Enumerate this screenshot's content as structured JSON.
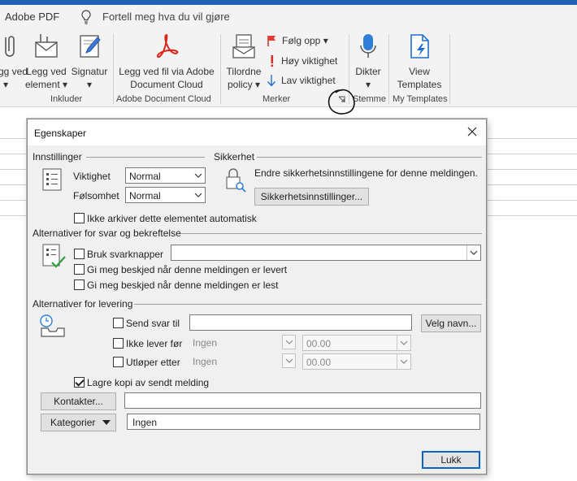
{
  "ribbon": {
    "tabs": [
      "Adobe PDF"
    ],
    "tell_me": "Fortell meg hva du vil gjøre",
    "buttons": {
      "legg_ved_fil": [
        "gg ved",
        "l ▾"
      ],
      "legg_ved_element": [
        "Legg ved",
        "element ▾"
      ],
      "signatur": [
        "Signatur",
        "▾"
      ],
      "adobe_cloud": [
        "Legg ved fil via Adobe",
        "Document Cloud"
      ],
      "tilordne": [
        "Tilordne",
        "policy ▾"
      ],
      "folg_opp": "Følg opp ▾",
      "hoy_viktighet": "Høy viktighet",
      "lav_viktighet": "Lav viktighet",
      "dikter": [
        "Dikter",
        "▾"
      ],
      "view_templates": [
        "View",
        "Templates"
      ]
    },
    "groups": {
      "inkluder": "Inkluder",
      "adobe_cloud": "Adobe Document Cloud",
      "merker": "Merker",
      "stemme": "Stemme",
      "my_templates": "My Templates"
    }
  },
  "dialog": {
    "title": "Egenskaper",
    "innstillinger": {
      "header": "Innstillinger",
      "viktighet_label": "Viktighet",
      "viktighet_value": "Normal",
      "folsomhet_label": "Følsomhet",
      "folsomhet_value": "Normal",
      "ikke_arkiver": "Ikke arkiver dette elementet automatisk"
    },
    "sikkerhet": {
      "header": "Sikkerhet",
      "description": "Endre sikkerhetsinnstillingene for denne meldingen.",
      "button": "Sikkerhetsinnstillinger..."
    },
    "svar": {
      "header": "Alternativer for svar og bekreftelse",
      "bruk_svarknapper": "Bruk svarknapper",
      "levert": "Gi meg beskjed når denne meldingen er levert",
      "lest": "Gi meg beskjed når denne meldingen er lest"
    },
    "levering": {
      "header": "Alternativer for levering",
      "send_svar_til": "Send svar til",
      "velg_navn": "Velg navn...",
      "ikke_lever_for": "Ikke lever før",
      "ikke_lever_date": "Ingen",
      "ikke_lever_time": "00.00",
      "utloper_etter": "Utløper etter",
      "utloper_date": "Ingen",
      "utloper_time": "00.00",
      "lagre_kopi": "Lagre kopi av sendt melding"
    },
    "kontakter_button": "Kontakter...",
    "kategorier_button": "Kategorier",
    "kategorier_value": "Ingen",
    "lukk_button": "Lukk"
  }
}
